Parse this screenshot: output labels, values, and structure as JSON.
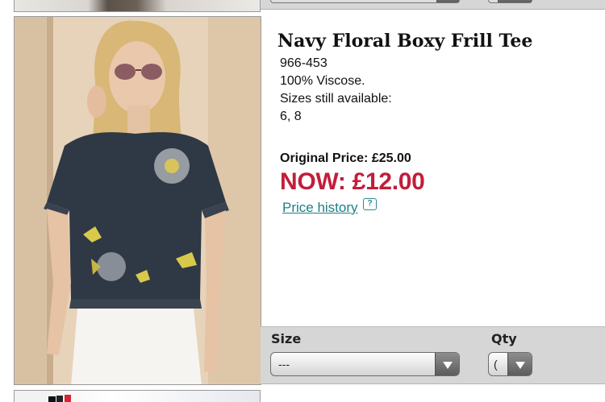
{
  "product": {
    "title": "Navy Floral Boxy Frill Tee",
    "sku": "966-453",
    "material": "100% Viscose.",
    "sizes_label": "Sizes still available:",
    "sizes": "6, 8",
    "original_price_label": "Original Price: £25.00",
    "now_price_label": "NOW: £12.00",
    "price_history_link": "Price history",
    "price_history_icon": "info-bubble-icon"
  },
  "options": {
    "size_label": "Size",
    "size_value": "---",
    "qty_label": "Qty",
    "qty_value": "("
  },
  "colors": {
    "now_price": "#c21e3a",
    "link": "#1e7f85",
    "options_bar": "#d6d6d6"
  }
}
